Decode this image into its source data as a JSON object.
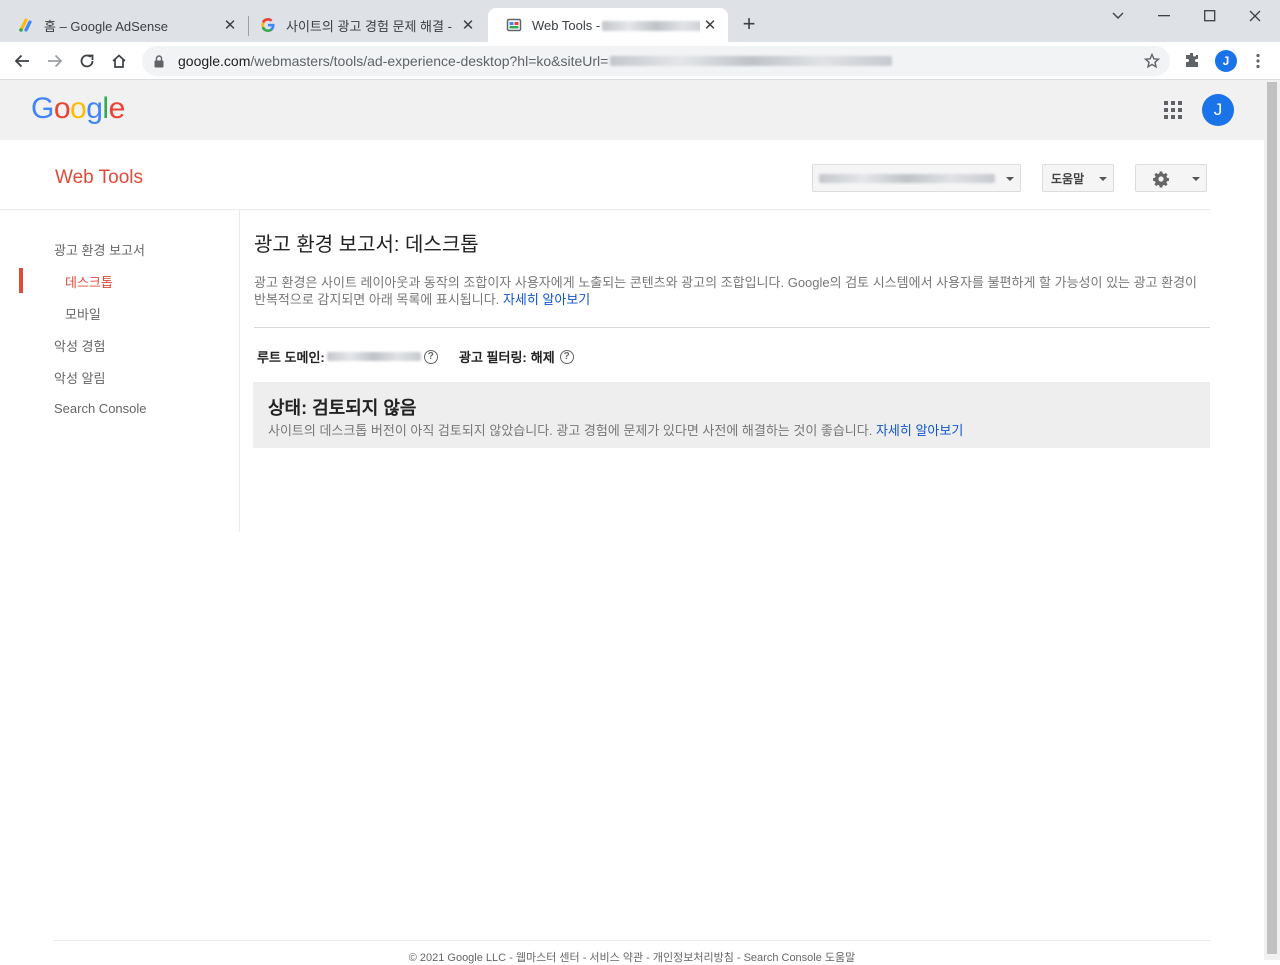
{
  "browser": {
    "tabs": [
      {
        "title": "홈 – Google AdSense",
        "favicon": "adsense-icon"
      },
      {
        "title": "사이트의 광고 경험 문제 해결 -",
        "favicon": "google-g-icon"
      },
      {
        "title": "Web Tools -",
        "favicon": "webtools-icon",
        "active": true
      }
    ],
    "url_host": "google.com",
    "url_path": "/webmasters/tools/ad-experience-desktop?hl=ko&siteUrl=",
    "profile_initial": "J"
  },
  "header": {
    "logo_letters": [
      "G",
      "o",
      "o",
      "g",
      "l",
      "e"
    ],
    "logo_colors": [
      "#4285f4",
      "#ea4335",
      "#fbbc05",
      "#4285f4",
      "#34a853",
      "#ea4335"
    ],
    "avatar_initial": "J"
  },
  "webtools": {
    "title": "Web Tools",
    "help_label": "도움말"
  },
  "sidebar": {
    "items": [
      {
        "label": "광고 환경 보고서",
        "level": 0
      },
      {
        "label": "데스크톱",
        "level": 1,
        "active": true
      },
      {
        "label": "모바일",
        "level": 1
      },
      {
        "label": "악성 경험",
        "level": 0
      },
      {
        "label": "악성 알림",
        "level": 0
      },
      {
        "label": "Search Console",
        "level": 0
      }
    ]
  },
  "main": {
    "title": "광고 환경 보고서: 데스크톱",
    "description": "광고 환경은 사이트 레이아웃과 동작의 조합이자 사용자에게 노출되는 콘텐츠와 광고의 조합입니다. Google의 검토 시스템에서 사용자를 불편하게 할 가능성이 있는 광고 환경이 반복적으로 감지되면 아래 목록에 표시됩니다.",
    "learn_more": "자세히 알아보기",
    "root_domain_label": "루트 도메인:",
    "ad_filtering_label": "광고 필터링:",
    "ad_filtering_value": "해제",
    "status_title": "상태: 검토되지 않음",
    "status_text": "사이트의 데스크톱 버전이 아직 검토되지 않았습니다. 광고 경험에 문제가 있다면 사전에 해결하는 것이 좋습니다.",
    "status_link": "자세히 알아보기"
  },
  "footer": {
    "text": "© 2021 Google LLC - 웹마스터 센터 - 서비스 약관 - 개인정보처리방침 - Search Console 도움말"
  }
}
